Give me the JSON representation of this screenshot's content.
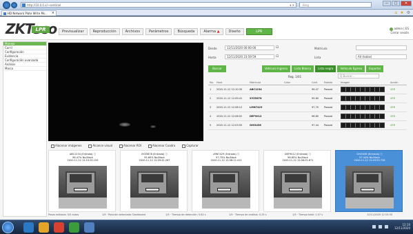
{
  "browser": {
    "url": "http://10.0.0.x/~sentinel",
    "url_tools": "▾ ✕",
    "search_placeholder": "Bing",
    "tab_title": "HD Network Plate Write Ms...",
    "tab_close": "×",
    "window_controls": [
      "—",
      "□",
      "✕"
    ]
  },
  "app": {
    "logo": "ZKTeco",
    "logo_badge": "LPR",
    "menu": [
      {
        "label": "Previsualizar"
      },
      {
        "label": "Reproducción"
      },
      {
        "label": "Archivos"
      },
      {
        "label": "Parámetros"
      },
      {
        "label": "Búsqueda"
      }
    ],
    "alarm_label": "Alarma",
    "alarm_icon": "▲",
    "extra_menu": "Diseño",
    "live_label": "LPR",
    "user_name": "admin | ES",
    "user_sub": "Cerrar sesión"
  },
  "sidebar": {
    "items": [
      {
        "label": "Manejo",
        "active": true
      },
      {
        "label": "Carril",
        "active": false
      },
      {
        "label": "Configuración",
        "active": false
      },
      {
        "label": "Evidencia",
        "active": false
      },
      {
        "label": "Configuración avanzada",
        "active": false
      },
      {
        "label": "Análisis",
        "active": false
      },
      {
        "label": "Marca",
        "active": false
      }
    ]
  },
  "video_toolbar": [
    "Alacenar imágenes",
    "Alcance visual",
    "Alacenar ROI",
    "Alacenar Cuadro",
    "Capturar"
  ],
  "search": {
    "start_label": "Desde",
    "start_value": "12/11/2020 00:00:00",
    "end_label": "Hasta",
    "end_value": "12/11/2020 23:59:59",
    "plate_label": "Matrícula",
    "plate_value": "",
    "type_label": "Lista",
    "type_value": "All (todas)",
    "calendar_icon": "⊡",
    "search_button": "Buscar",
    "filter_tabs": [
      {
        "label": "Vehículo Ingreso",
        "selected": false
      },
      {
        "label": "Lista Blanca",
        "selected": false
      },
      {
        "label": "Lista negra",
        "selected": true
      },
      {
        "label": "Vehículo Egreso",
        "selected": false
      },
      {
        "label": "Exportar",
        "selected": false
      }
    ],
    "results_label": "Reg. 1/01",
    "results_search_placeholder": "Q Buscar..."
  },
  "table": {
    "columns": [
      "No.",
      "Hora",
      "Matrícula",
      "Color",
      "Conf.",
      "Estado",
      "Imagen",
      "Acción"
    ],
    "rows": [
      {
        "no": "1",
        "time": "2020-11-12 12:10:30",
        "plate": "ABC1234",
        "color": "",
        "conf": "96.47",
        "status": "Passed",
        "action": "VER"
      },
      {
        "no": "2",
        "time": "2020-11-12 12:09:41",
        "plate": "XYZ5678",
        "color": "",
        "conf": "95.60",
        "status": "Passed",
        "action": "VER"
      },
      {
        "no": "3",
        "time": "2020-11-12 12:08:12",
        "plate": "LMN7429",
        "color": "",
        "conf": "97.70",
        "status": "Passed",
        "action": "VER"
      },
      {
        "no": "4",
        "time": "2020-11-12 12:06:02",
        "plate": "DEF9012",
        "color": "",
        "conf": "96.80",
        "status": "Passed",
        "action": "VER"
      },
      {
        "no": "5",
        "time": "2020-11-12 12:03:55",
        "plate": "GHI3456",
        "color": "",
        "conf": "97.44",
        "status": "Passed",
        "action": "VER"
      }
    ]
  },
  "thumbnails": [
    {
      "line1": "ABC1234 (Entrada) ⓘ",
      "line2": "96.47% No.Black",
      "line3": "2020-11-12 12:10:30.159",
      "selected": false
    },
    {
      "line1": "XYZ5678 (Entrada) ⓘ",
      "line2": "95.60% No.Black",
      "line3": "2020-11-12 12:09:41.267",
      "selected": false
    },
    {
      "line1": "LMN7429 (Entrada) ⓘ",
      "line2": "97.70% No.Black",
      "line3": "2020-11-12 12:08:12.413",
      "selected": false
    },
    {
      "line1": "DEF9012 (Entrada) ⓘ",
      "line2": "96.80% No.Black",
      "line3": "2020-11-12 12:06:02.871",
      "selected": false
    },
    {
      "line1": "GHI3456 (Entrada) ⓘ",
      "line2": "97.44% No.Black",
      "line3": "2020-11-12 12:03:55.728",
      "selected": true
    }
  ],
  "status_bar": {
    "left": "Pasos exitosos: 5/5 autos",
    "mid1": "1/5 · Posición detectada: Dashboard",
    "mid2": "1/5 · Tiempo de detección: 0.82 s",
    "mid3": "1/5 · Tiempo de análisis: 0.25 s",
    "mid4": "1/5 · Tiempo total: 1.07 s",
    "right": "12/11/2020 12:10:30"
  },
  "taskbar": {
    "time": "12:10",
    "date": "12/11/2020",
    "icon_colors": [
      "#2b78c5",
      "#e4a428",
      "#d8412f",
      "#3b9b3b",
      "#5080c0"
    ]
  }
}
